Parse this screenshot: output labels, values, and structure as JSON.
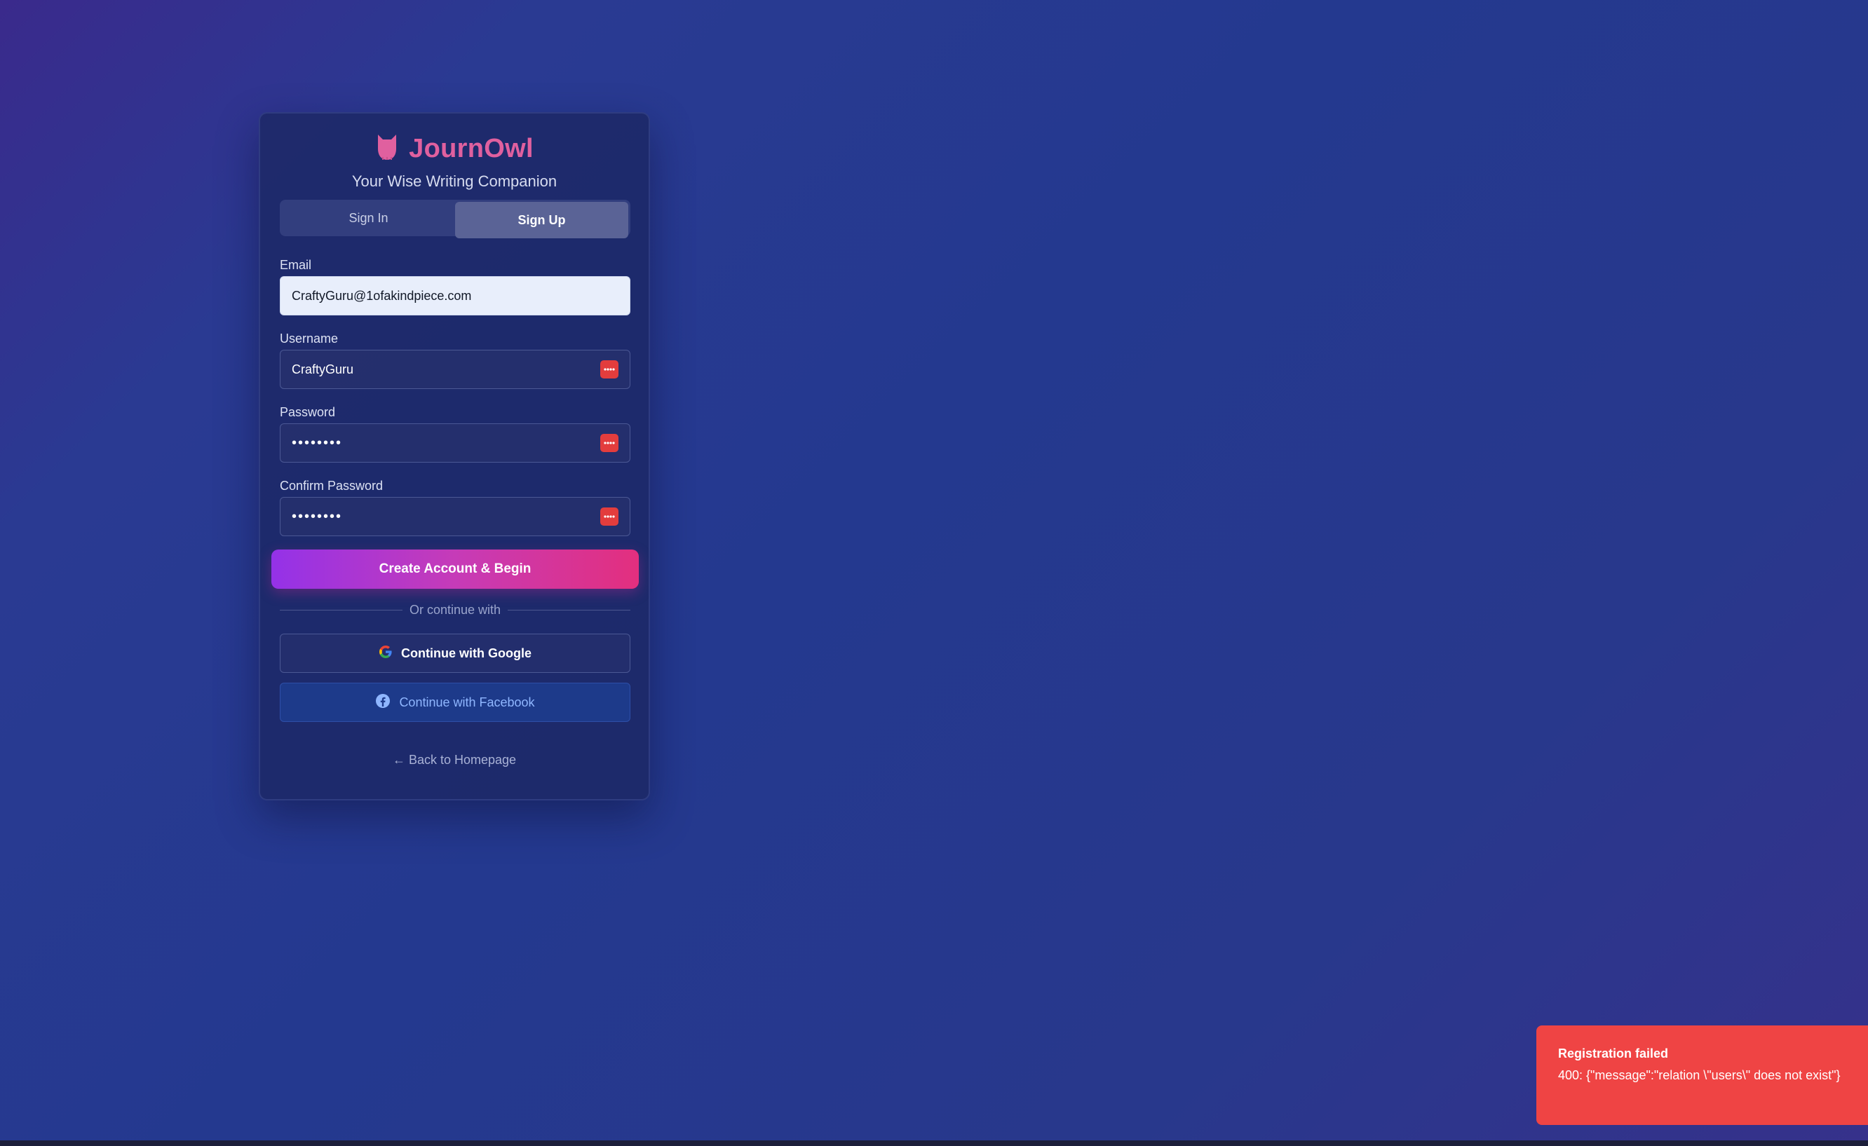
{
  "brand": {
    "title": "JournOwl",
    "tagline": "Your Wise Writing Companion",
    "icon": "owl-icon"
  },
  "tabs": [
    {
      "label": "Sign In",
      "active": false
    },
    {
      "label": "Sign Up",
      "active": true
    }
  ],
  "form": {
    "email": {
      "label": "Email",
      "value": "CraftyGuru@1ofakindpiece.com"
    },
    "username": {
      "label": "Username",
      "value": "CraftyGuru"
    },
    "password": {
      "label": "Password",
      "value": "••••••••"
    },
    "confirm_password": {
      "label": "Confirm Password",
      "value": "••••••••"
    },
    "submit_label": "Create Account & Begin"
  },
  "divider_text": "Or continue with",
  "oauth": {
    "google_label": "Continue with Google",
    "facebook_label": "Continue with Facebook"
  },
  "back_link": "← Back to Homepage",
  "toast": {
    "title": "Registration failed",
    "message": "400: {\"message\":\"relation \\\"users\\\" does not exist\"}"
  },
  "colors": {
    "brand": "#e0609f",
    "toast": "#ef4444",
    "password_manager_icon": "#e33d3d"
  }
}
